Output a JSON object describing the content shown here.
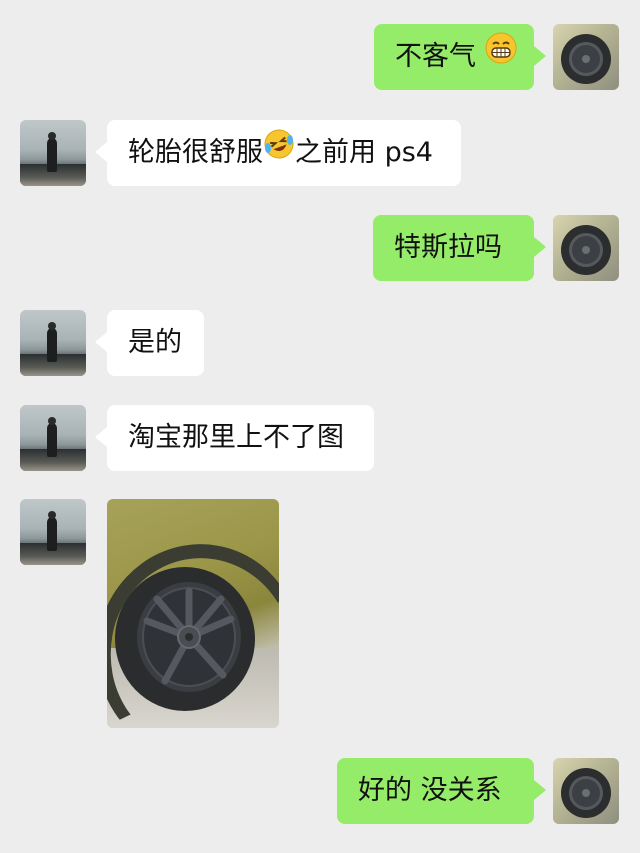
{
  "messages": [
    {
      "side": "right",
      "text": "不客气",
      "emoji": "grinning-face-emoji"
    },
    {
      "side": "left",
      "text_before": "轮胎很舒服",
      "emoji": "crying-laughing-emoji",
      "text_after": "之前用 ps4"
    },
    {
      "side": "right",
      "text": "特斯拉吗"
    },
    {
      "side": "left",
      "text": "是的"
    },
    {
      "side": "left",
      "text": "淘宝那里上不了图"
    },
    {
      "side": "left",
      "type": "image",
      "image": "car-wheel-photo"
    },
    {
      "side": "right",
      "text": "好的 没关系"
    }
  ],
  "colors": {
    "background": "#ededed",
    "sent_bubble": "#95ec69",
    "received_bubble": "#ffffff"
  }
}
